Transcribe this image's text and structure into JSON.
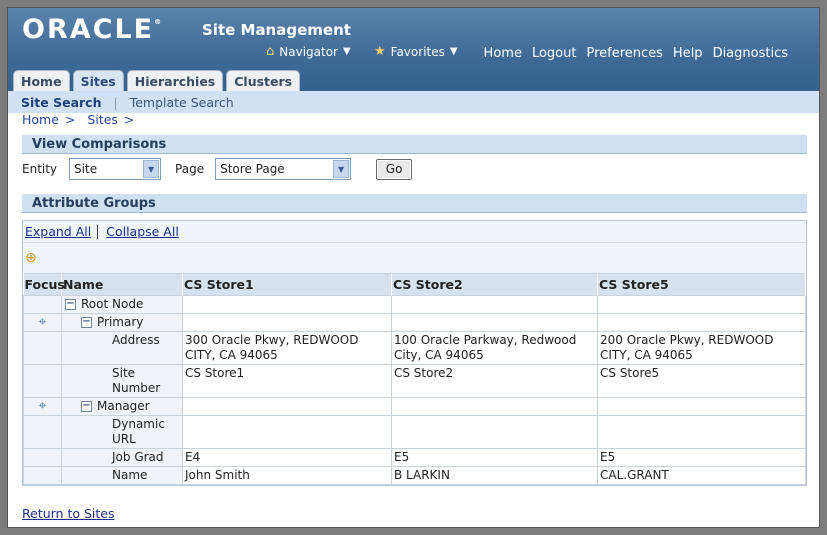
{
  "header": {
    "logo": "ORACLE",
    "logo_tm": "®",
    "app_title": "Site Management",
    "navigator_label": "Navigator",
    "favorites_label": "Favorites",
    "global_links": [
      "Home",
      "Logout",
      "Preferences",
      "Help",
      "Diagnostics"
    ]
  },
  "tabs": [
    {
      "label": "Home",
      "active": false
    },
    {
      "label": "Sites",
      "active": true
    },
    {
      "label": "Hierarchies",
      "active": false
    },
    {
      "label": "Clusters",
      "active": false
    }
  ],
  "subtabs": {
    "active": "Site Search",
    "other": "Template Search"
  },
  "breadcrumbs": [
    "Home",
    ">",
    "Sites",
    ">"
  ],
  "view_comparisons": {
    "title": "View Comparisons",
    "entity_label": "Entity",
    "entity_value": "Site",
    "page_label": "Page",
    "page_value": "Store Page",
    "go_label": "Go"
  },
  "attribute_groups": {
    "title": "Attribute Groups",
    "expand_all": "Expand All",
    "collapse_all": "Collapse All",
    "columns": [
      "Focus",
      "Name",
      "CS Store1",
      "CS Store2",
      "CS Store5"
    ],
    "rows": {
      "root": {
        "name": "Root Node"
      },
      "primary": {
        "name": "Primary"
      },
      "address": {
        "name": "Address",
        "values": [
          "300 Oracle Pkwy, REDWOOD CITY, CA 94065",
          "100 Oracle Parkway, Redwood City, CA 94065",
          "200 Oracle Pkwy, REDWOOD CITY, CA 94065"
        ]
      },
      "site_number": {
        "name": "Site Number",
        "values": [
          "CS Store1",
          "CS Store2",
          "CS Store5"
        ]
      },
      "manager": {
        "name": "Manager"
      },
      "dynamic_url": {
        "name": "Dynamic URL",
        "values": [
          "",
          "",
          ""
        ]
      },
      "job_grad": {
        "name": "Job Grad",
        "values": [
          "E4",
          "E5",
          "E5"
        ]
      },
      "person_name": {
        "name": "Name",
        "values": [
          "John Smith",
          "B LARKIN",
          "CAL.GRANT"
        ]
      }
    }
  },
  "footer": {
    "return_link": "Return to Sites"
  }
}
